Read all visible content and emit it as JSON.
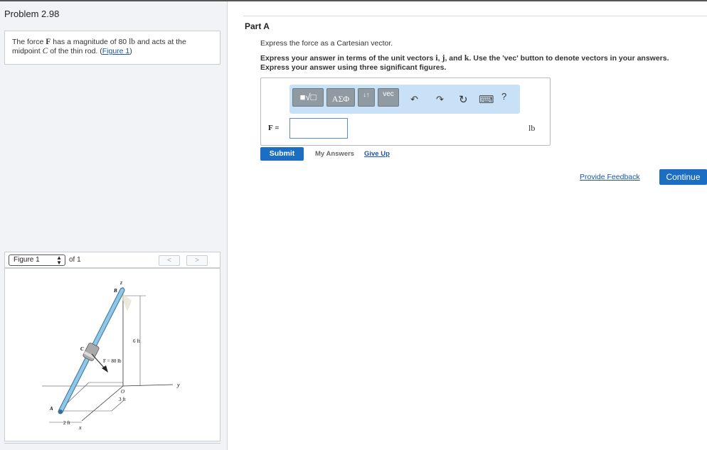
{
  "problem": {
    "title": "Problem 2.98",
    "text_prefix": "The force ",
    "force_symbol": "F",
    "text_mid1": " has a magnitude of 80 ",
    "unit_lb": "lb",
    "text_mid2": " and acts at the midpoint ",
    "point_symbol": "C",
    "text_mid3": " of the thin rod. (",
    "figure_link": "Figure 1",
    "text_suffix": ")"
  },
  "figure_nav": {
    "selected": "Figure 1",
    "of_label": "of 1",
    "prev_label": "<",
    "next_label": ">"
  },
  "figure": {
    "labels": {
      "z": "z",
      "B": "B",
      "C": "C",
      "A": "A",
      "O": "O",
      "y": "y",
      "x": "x",
      "six_ft": "6 ft",
      "force": "F = 80 lb",
      "three_ft": "3 ft",
      "two_ft": "2 ft"
    }
  },
  "part": {
    "title": "Part A",
    "instruction": "Express the force as a Cartesian vector.",
    "instruction2_prefix": "Express your answer in terms of the unit vectors ",
    "unit_i": "i",
    "unit_j": "j",
    "unit_k": "k",
    "instruction2_suffix": ". Use the 'vec' button to denote vectors in your answers.",
    "instruction3": "Express your answer using three significant figures."
  },
  "toolbar": {
    "templates_label": "■√□",
    "greek_label": "ΑΣΦ",
    "arrows_label": "↓↑",
    "vec_label": "vec",
    "undo_icon": "↶",
    "redo_icon": "↷",
    "reset_icon": "↻",
    "keyboard_icon": "⌨",
    "help_label": "?"
  },
  "answer": {
    "label": "F",
    "equals": "=",
    "value": "",
    "unit": "lb"
  },
  "actions": {
    "submit": "Submit",
    "my_answers": "My Answers",
    "give_up": "Give Up",
    "provide_feedback": "Provide Feedback",
    "continue": "Continue"
  }
}
